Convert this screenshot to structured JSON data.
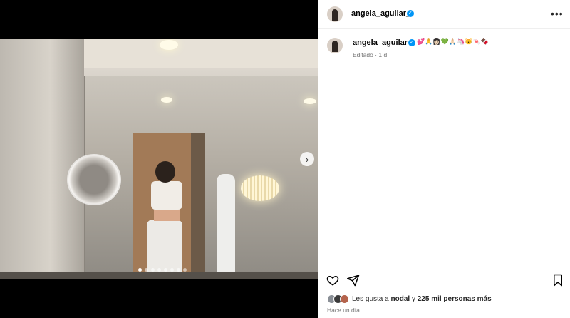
{
  "post": {
    "username": "angela_aguilar_",
    "verified": true,
    "caption_emoji": "💕🙏👩🏻💚🙏🏻🦄🐱🍬🍫",
    "edited_label": "Editado",
    "edited_time": "1 d",
    "image_count": 8,
    "active_image_index": 1
  },
  "header": {
    "username": "angela_aguilar_",
    "more_icon": "more-horizontal-icon"
  },
  "actions": {
    "like_icon": "heart-icon",
    "share_icon": "send-icon",
    "save_icon": "bookmark-icon"
  },
  "likes": {
    "prefix": "Les gusta a",
    "first_liker": "nodal",
    "connector": "y",
    "others": "225 mil personas más"
  },
  "time_ago": "Hace un día",
  "colors": {
    "verified": "#0095f6",
    "secondary_text": "#737373",
    "border": "#efefef"
  }
}
